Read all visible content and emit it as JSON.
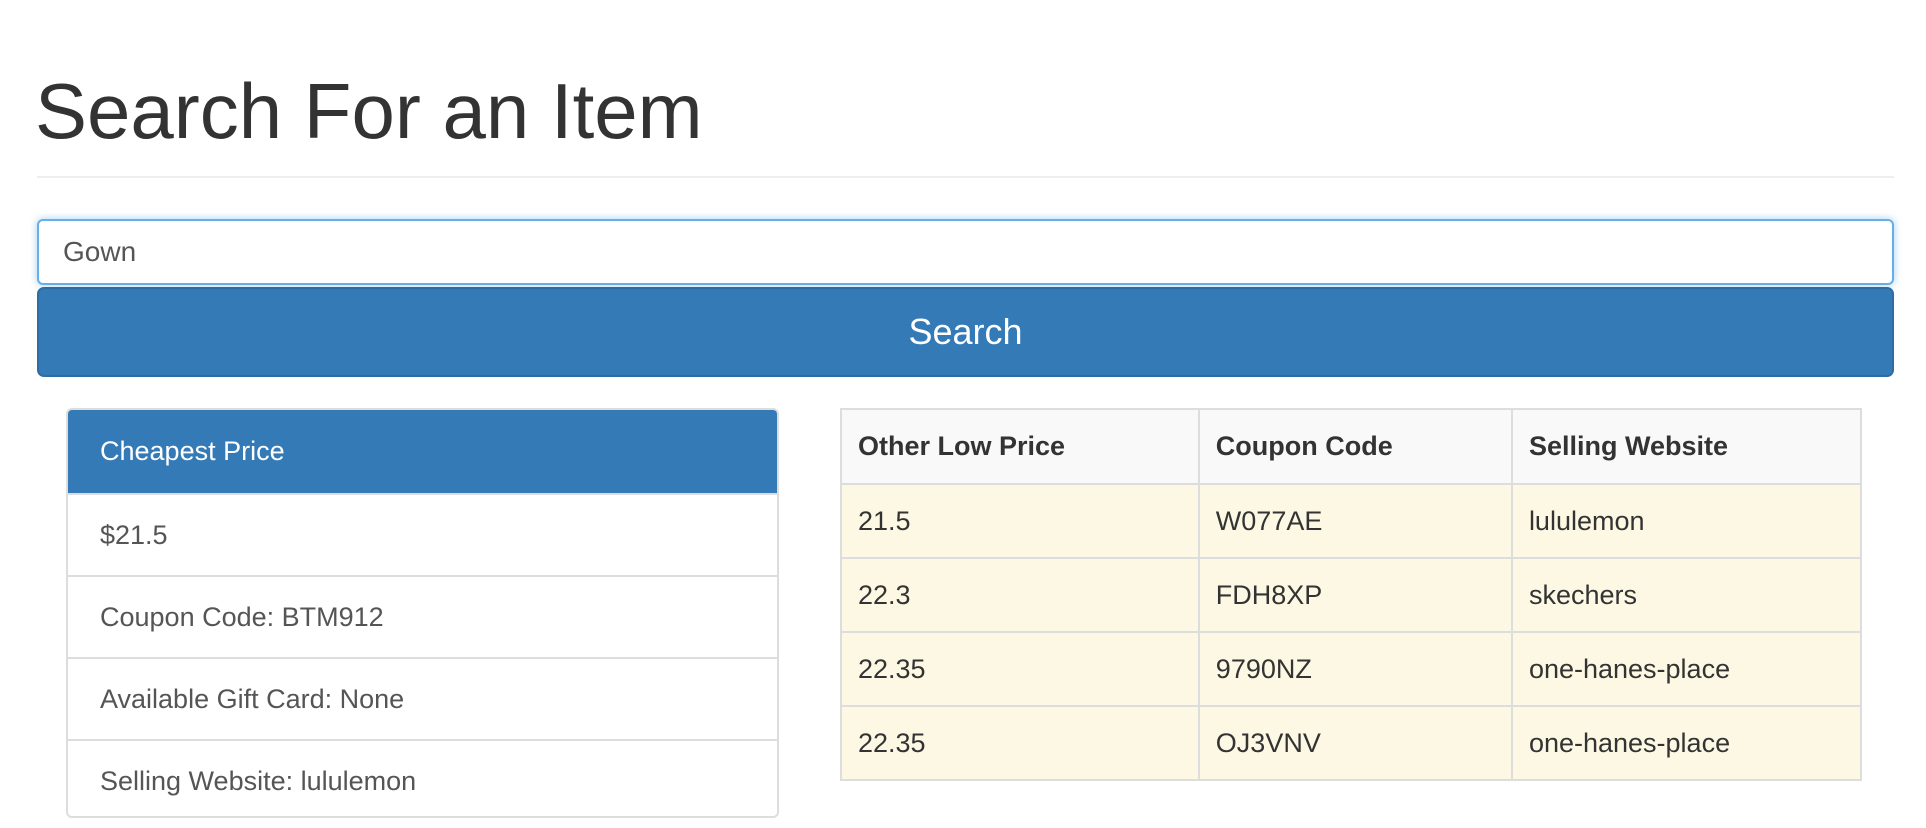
{
  "page": {
    "title": "Search For an Item"
  },
  "search": {
    "value": "Gown",
    "button_label": "Search"
  },
  "cheapest": {
    "header": "Cheapest Price",
    "price": "$21.5",
    "coupon": "Coupon Code: BTM912",
    "gift_card": "Available Gift Card: None",
    "website": "Selling Website: lululemon"
  },
  "table": {
    "headers": [
      "Other Low Price",
      "Coupon Code",
      "Selling Website"
    ],
    "rows": [
      [
        "21.5",
        "W077AE",
        "lululemon"
      ],
      [
        "22.3",
        "FDH8XP",
        "skechers"
      ],
      [
        "22.35",
        "9790NZ",
        "one-hanes-place"
      ],
      [
        "22.35",
        "OJ3VNV",
        "one-hanes-place"
      ]
    ]
  },
  "colors": {
    "primary": "#337ab7",
    "warning_row": "#fcf8e3"
  }
}
